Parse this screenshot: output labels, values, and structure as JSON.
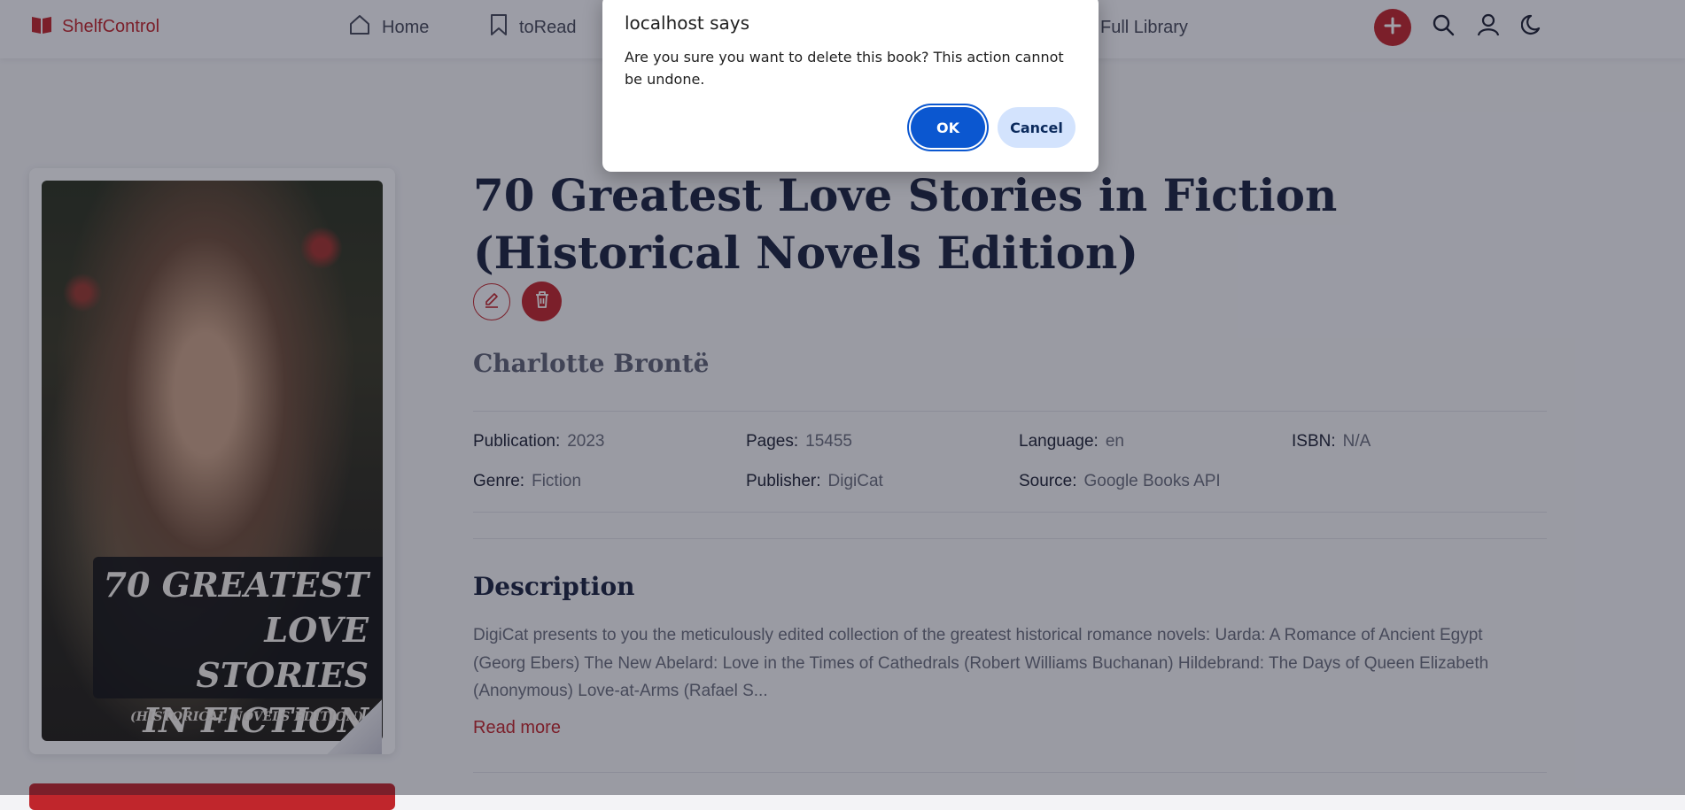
{
  "header": {
    "brand": "ShelfControl",
    "nav": [
      {
        "label": "Home",
        "icon": "home-icon"
      },
      {
        "label": "toRead",
        "icon": "bookmark-icon"
      },
      {
        "label": "Full Library",
        "icon": "library-icon"
      }
    ],
    "icons": [
      "plus-icon",
      "search-icon",
      "user-icon",
      "moon-icon"
    ],
    "accent_color": "#c0262c"
  },
  "book": {
    "cover_title": "70 GREATEST\nLOVE STORIES\nIN FICTION",
    "cover_subtitle": "(HISTORICAL NOVELS EDITION)",
    "title": "70 Greatest Love Stories in Fiction\n(Historical Novels Edition)",
    "author": "Charlotte Brontë",
    "meta": {
      "publication_label": "Publication:",
      "publication_value": "2023",
      "pages_label": "Pages:",
      "pages_value": "15455",
      "language_label": "Language:",
      "language_value": "en",
      "isbn_label": "ISBN:",
      "isbn_value": "N/A",
      "genre_label": "Genre:",
      "genre_value": "Fiction",
      "publisher_label": "Publisher:",
      "publisher_value": "DigiCat",
      "source_label": "Source:",
      "source_value": "Google Books API"
    },
    "description_heading": "Description",
    "description": "DigiCat presents to you the meticulously edited collection of the greatest historical romance novels: Uarda: A Romance of Ancient Egypt (Georg Ebers) The New Abelard: Love in the Times of Cathedrals (Robert Williams Buchanan) Hildebrand: The Days of Queen Elizabeth (Anonymous) Love-at-Arms (Rafael S...",
    "read_more": "Read more"
  },
  "dialog": {
    "title": "localhost says",
    "message": "Are you sure you want to delete this book? This action cannot be undone.",
    "ok_label": "OK",
    "cancel_label": "Cancel",
    "ok_color": "#0b57d0",
    "cancel_color": "#d3e3fd"
  }
}
